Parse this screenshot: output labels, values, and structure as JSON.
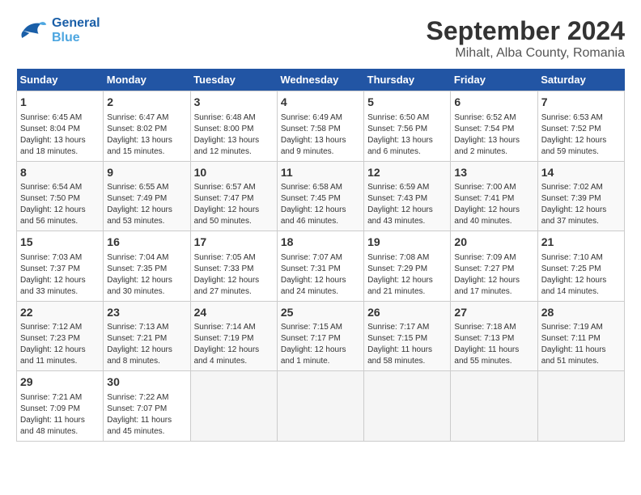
{
  "logo": {
    "line1": "General",
    "line2": "Blue"
  },
  "title": "September 2024",
  "subtitle": "Mihalt, Alba County, Romania",
  "days_of_week": [
    "Sunday",
    "Monday",
    "Tuesday",
    "Wednesday",
    "Thursday",
    "Friday",
    "Saturday"
  ],
  "weeks": [
    [
      {
        "day": 1,
        "info": "Sunrise: 6:45 AM\nSunset: 8:04 PM\nDaylight: 13 hours and 18 minutes."
      },
      {
        "day": 2,
        "info": "Sunrise: 6:47 AM\nSunset: 8:02 PM\nDaylight: 13 hours and 15 minutes."
      },
      {
        "day": 3,
        "info": "Sunrise: 6:48 AM\nSunset: 8:00 PM\nDaylight: 13 hours and 12 minutes."
      },
      {
        "day": 4,
        "info": "Sunrise: 6:49 AM\nSunset: 7:58 PM\nDaylight: 13 hours and 9 minutes."
      },
      {
        "day": 5,
        "info": "Sunrise: 6:50 AM\nSunset: 7:56 PM\nDaylight: 13 hours and 6 minutes."
      },
      {
        "day": 6,
        "info": "Sunrise: 6:52 AM\nSunset: 7:54 PM\nDaylight: 13 hours and 2 minutes."
      },
      {
        "day": 7,
        "info": "Sunrise: 6:53 AM\nSunset: 7:52 PM\nDaylight: 12 hours and 59 minutes."
      }
    ],
    [
      {
        "day": 8,
        "info": "Sunrise: 6:54 AM\nSunset: 7:50 PM\nDaylight: 12 hours and 56 minutes."
      },
      {
        "day": 9,
        "info": "Sunrise: 6:55 AM\nSunset: 7:49 PM\nDaylight: 12 hours and 53 minutes."
      },
      {
        "day": 10,
        "info": "Sunrise: 6:57 AM\nSunset: 7:47 PM\nDaylight: 12 hours and 50 minutes."
      },
      {
        "day": 11,
        "info": "Sunrise: 6:58 AM\nSunset: 7:45 PM\nDaylight: 12 hours and 46 minutes."
      },
      {
        "day": 12,
        "info": "Sunrise: 6:59 AM\nSunset: 7:43 PM\nDaylight: 12 hours and 43 minutes."
      },
      {
        "day": 13,
        "info": "Sunrise: 7:00 AM\nSunset: 7:41 PM\nDaylight: 12 hours and 40 minutes."
      },
      {
        "day": 14,
        "info": "Sunrise: 7:02 AM\nSunset: 7:39 PM\nDaylight: 12 hours and 37 minutes."
      }
    ],
    [
      {
        "day": 15,
        "info": "Sunrise: 7:03 AM\nSunset: 7:37 PM\nDaylight: 12 hours and 33 minutes."
      },
      {
        "day": 16,
        "info": "Sunrise: 7:04 AM\nSunset: 7:35 PM\nDaylight: 12 hours and 30 minutes."
      },
      {
        "day": 17,
        "info": "Sunrise: 7:05 AM\nSunset: 7:33 PM\nDaylight: 12 hours and 27 minutes."
      },
      {
        "day": 18,
        "info": "Sunrise: 7:07 AM\nSunset: 7:31 PM\nDaylight: 12 hours and 24 minutes."
      },
      {
        "day": 19,
        "info": "Sunrise: 7:08 AM\nSunset: 7:29 PM\nDaylight: 12 hours and 21 minutes."
      },
      {
        "day": 20,
        "info": "Sunrise: 7:09 AM\nSunset: 7:27 PM\nDaylight: 12 hours and 17 minutes."
      },
      {
        "day": 21,
        "info": "Sunrise: 7:10 AM\nSunset: 7:25 PM\nDaylight: 12 hours and 14 minutes."
      }
    ],
    [
      {
        "day": 22,
        "info": "Sunrise: 7:12 AM\nSunset: 7:23 PM\nDaylight: 12 hours and 11 minutes."
      },
      {
        "day": 23,
        "info": "Sunrise: 7:13 AM\nSunset: 7:21 PM\nDaylight: 12 hours and 8 minutes."
      },
      {
        "day": 24,
        "info": "Sunrise: 7:14 AM\nSunset: 7:19 PM\nDaylight: 12 hours and 4 minutes."
      },
      {
        "day": 25,
        "info": "Sunrise: 7:15 AM\nSunset: 7:17 PM\nDaylight: 12 hours and 1 minute."
      },
      {
        "day": 26,
        "info": "Sunrise: 7:17 AM\nSunset: 7:15 PM\nDaylight: 11 hours and 58 minutes."
      },
      {
        "day": 27,
        "info": "Sunrise: 7:18 AM\nSunset: 7:13 PM\nDaylight: 11 hours and 55 minutes."
      },
      {
        "day": 28,
        "info": "Sunrise: 7:19 AM\nSunset: 7:11 PM\nDaylight: 11 hours and 51 minutes."
      }
    ],
    [
      {
        "day": 29,
        "info": "Sunrise: 7:21 AM\nSunset: 7:09 PM\nDaylight: 11 hours and 48 minutes."
      },
      {
        "day": 30,
        "info": "Sunrise: 7:22 AM\nSunset: 7:07 PM\nDaylight: 11 hours and 45 minutes."
      },
      null,
      null,
      null,
      null,
      null
    ]
  ]
}
